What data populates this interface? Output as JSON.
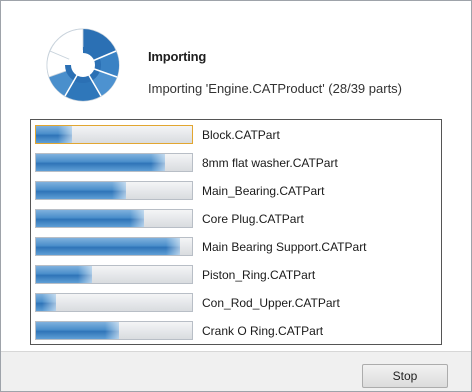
{
  "dialog": {
    "title": "Importing",
    "status": "Importing 'Engine.CATProduct' (28/39 parts)",
    "logo_icon": "import-progress-wheel-icon",
    "accent": "#2f74b8",
    "focus_border": "#e2a630"
  },
  "parts": [
    {
      "name": "Block.CATPart",
      "progress": 0.23
    },
    {
      "name": "8mm flat washer.CATPart",
      "progress": 0.83
    },
    {
      "name": "Main_Bearing.CATPart",
      "progress": 0.58
    },
    {
      "name": "Core Plug.CATPart",
      "progress": 0.69
    },
    {
      "name": "Main Bearing Support.CATPart",
      "progress": 0.92
    },
    {
      "name": "Piston_Ring.CATPart",
      "progress": 0.36
    },
    {
      "name": "Con_Rod_Upper.CATPart",
      "progress": 0.13
    },
    {
      "name": "Crank O Ring.CATPart",
      "progress": 0.53
    }
  ],
  "footer": {
    "stop_label": "Stop"
  }
}
